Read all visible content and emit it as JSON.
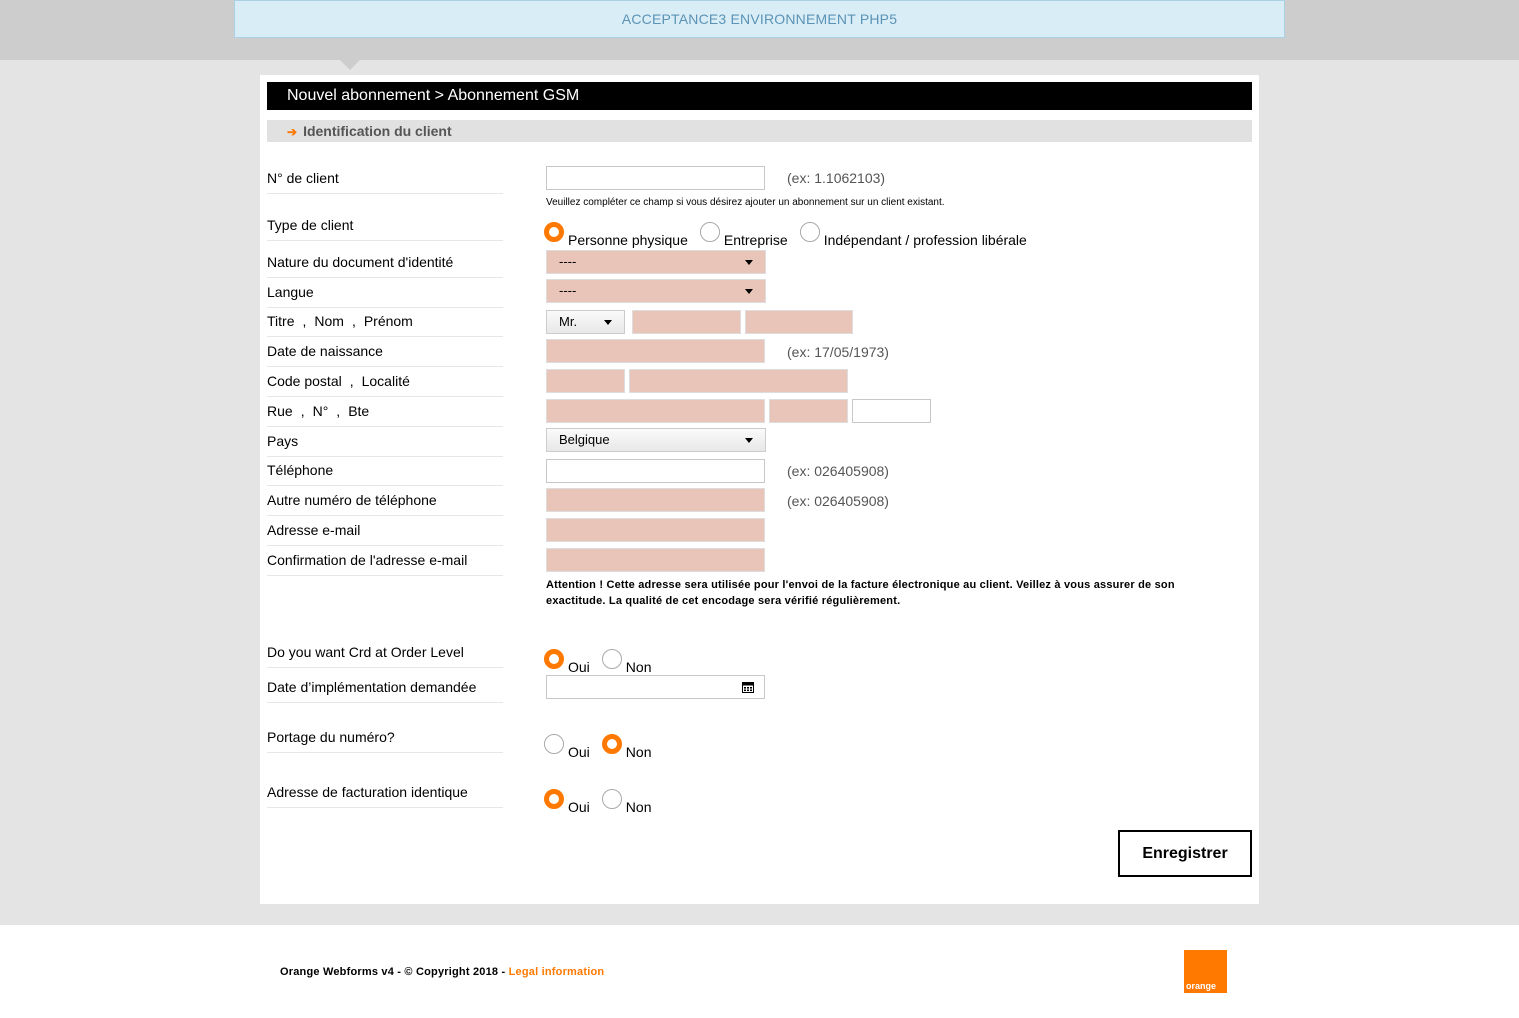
{
  "env_banner": "ACCEPTANCE3 ENVIRONNEMENT PHP5",
  "title": "Nouvel abonnement > Abonnement GSM",
  "section": "Identification du client",
  "labels": {
    "client_no": "N° de client",
    "client_type": "Type de client",
    "id_doc": "Nature du document d'identité",
    "lang": "Langue",
    "titre": "Titre",
    "nom": "Nom",
    "prenom": "Prénom",
    "birth": "Date de naissance",
    "cp": "Code postal",
    "loc": "Localité",
    "rue": "Rue",
    "num": "N°",
    "bte": "Bte",
    "pays": "Pays",
    "tel": "Téléphone",
    "tel2": "Autre numéro de téléphone",
    "email": "Adresse e-mail",
    "email2": "Confirmation de l'adresse e-mail",
    "crd": "Do you want Crd at Order Level",
    "impl": "Date d’implémentation demandée",
    "portage": "Portage du numéro?",
    "billing": "Adresse de facturation identique"
  },
  "hints": {
    "client_no": "(ex: 1.1062103)",
    "client_no_note": "Veuillez compléter ce champ si vous désirez ajouter un abonnement sur un client existant.",
    "birth": "(ex: 17/05/1973)",
    "tel": "(ex: 026405908)",
    "tel2": "(ex: 026405908)",
    "email_warning": "Attention ! Cette adresse sera utilisée pour l'envoi de la facture électronique au client. Veillez à vous assurer de son exactitude. La qualité de cet encodage sera vérifié régulièrement."
  },
  "client_type_options": [
    "Personne physique",
    "Entreprise",
    "Indépendant / profession libérale"
  ],
  "selects": {
    "id_doc": "----",
    "lang": "----",
    "titre": "Mr.",
    "pays": "Belgique"
  },
  "yes": "Oui",
  "no": "Non",
  "separator": ",",
  "save_button": "Enregistrer",
  "footer": {
    "copyright": "Orange Webforms v4 - © Copyright 2018 - ",
    "legal": "Legal information",
    "logo_text": "orange"
  },
  "colors": {
    "accent": "#ff7900",
    "required_field": "#e8c5b8",
    "banner": "#d9edf7"
  },
  "icons": [
    "arrow-right-icon",
    "calendar-icon",
    "caret-down-icon",
    "orange-logo"
  ]
}
